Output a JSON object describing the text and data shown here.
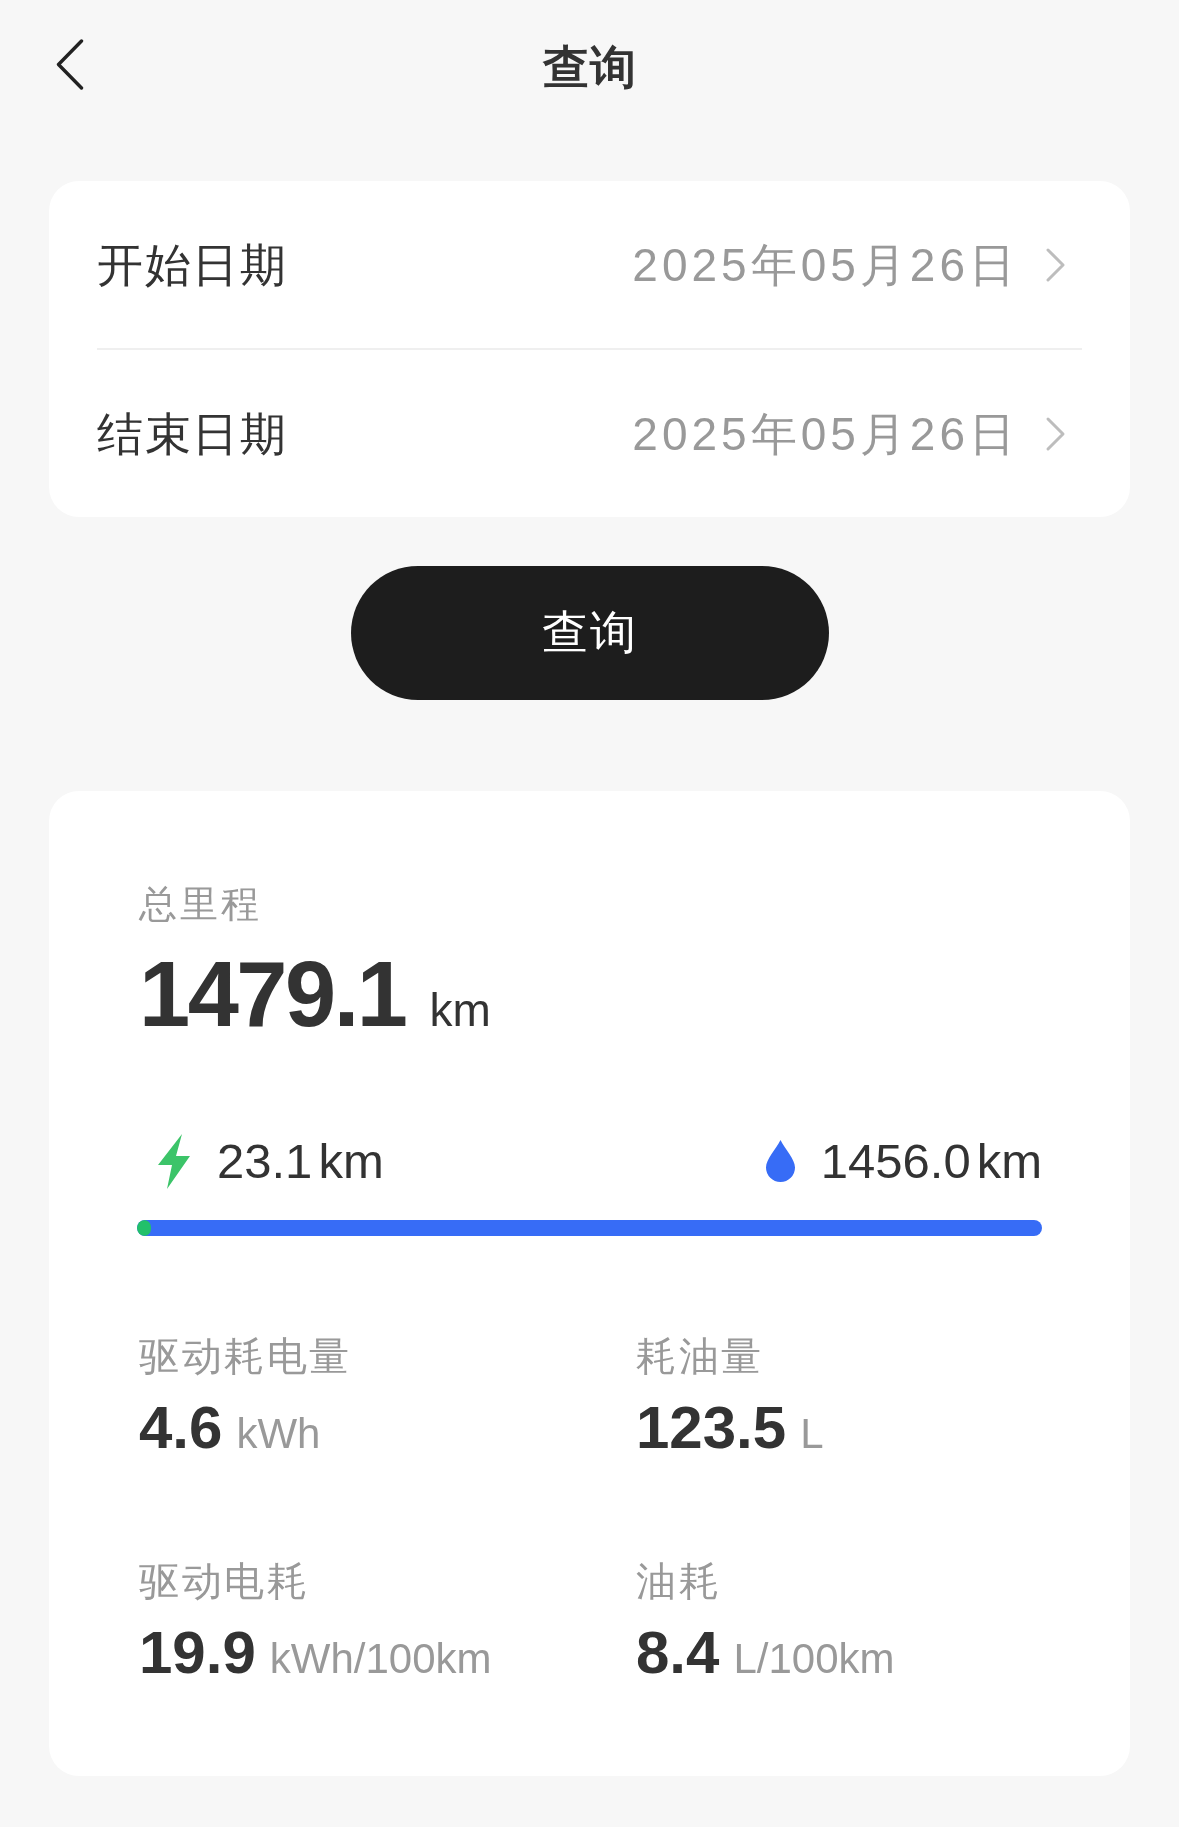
{
  "header": {
    "title": "查询"
  },
  "date_range": [
    {
      "label": "开始日期",
      "value": "2025年05月26日"
    },
    {
      "label": "结束日期",
      "value": "2025年05月26日"
    }
  ],
  "query_button": {
    "label": "查询"
  },
  "summary": {
    "total": {
      "label": "总里程",
      "value": "1479.1",
      "unit": "km"
    },
    "split": {
      "level": 0.016,
      "segments": [
        {
          "kind": "electric",
          "value": "23.1",
          "unit": "km"
        },
        {
          "kind": "fuel",
          "value": "1456.0",
          "unit": "km"
        }
      ]
    },
    "stats": [
      {
        "label": "驱动耗电量",
        "value": "4.6",
        "unit": "kWh"
      },
      {
        "label": "耗油量",
        "value": "123.5",
        "unit": "L"
      },
      {
        "label": "驱动电耗",
        "value": "19.9",
        "unit": "kWh/100km"
      },
      {
        "label": "油耗",
        "value": "8.4",
        "unit": "L/100km"
      }
    ]
  }
}
